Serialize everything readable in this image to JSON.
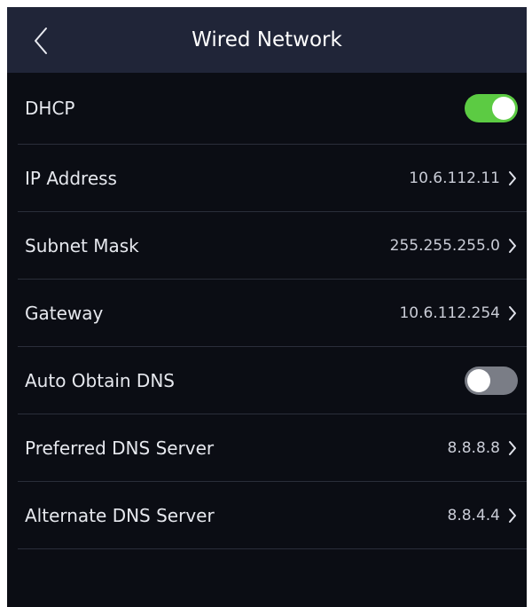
{
  "header": {
    "title": "Wired Network",
    "back_icon": "chevron-left-icon"
  },
  "settings": [
    {
      "label": "DHCP",
      "type": "toggle",
      "state": "on"
    },
    {
      "label": "IP Address",
      "type": "value",
      "value": "10.6.112.11"
    },
    {
      "label": "Subnet Mask",
      "type": "value",
      "value": "255.255.255.0"
    },
    {
      "label": "Gateway",
      "type": "value",
      "value": "10.6.112.254"
    },
    {
      "label": "Auto Obtain DNS",
      "type": "toggle",
      "state": "off"
    },
    {
      "label": "Preferred DNS Server",
      "type": "value",
      "value": "8.8.8.8"
    },
    {
      "label": "Alternate DNS Server",
      "type": "value",
      "value": "8.8.4.4"
    }
  ],
  "colors": {
    "header_bg": "#202538",
    "screen_bg": "#0b0d14",
    "toggle_on": "#5ccb43",
    "toggle_off": "#7a7d86"
  }
}
